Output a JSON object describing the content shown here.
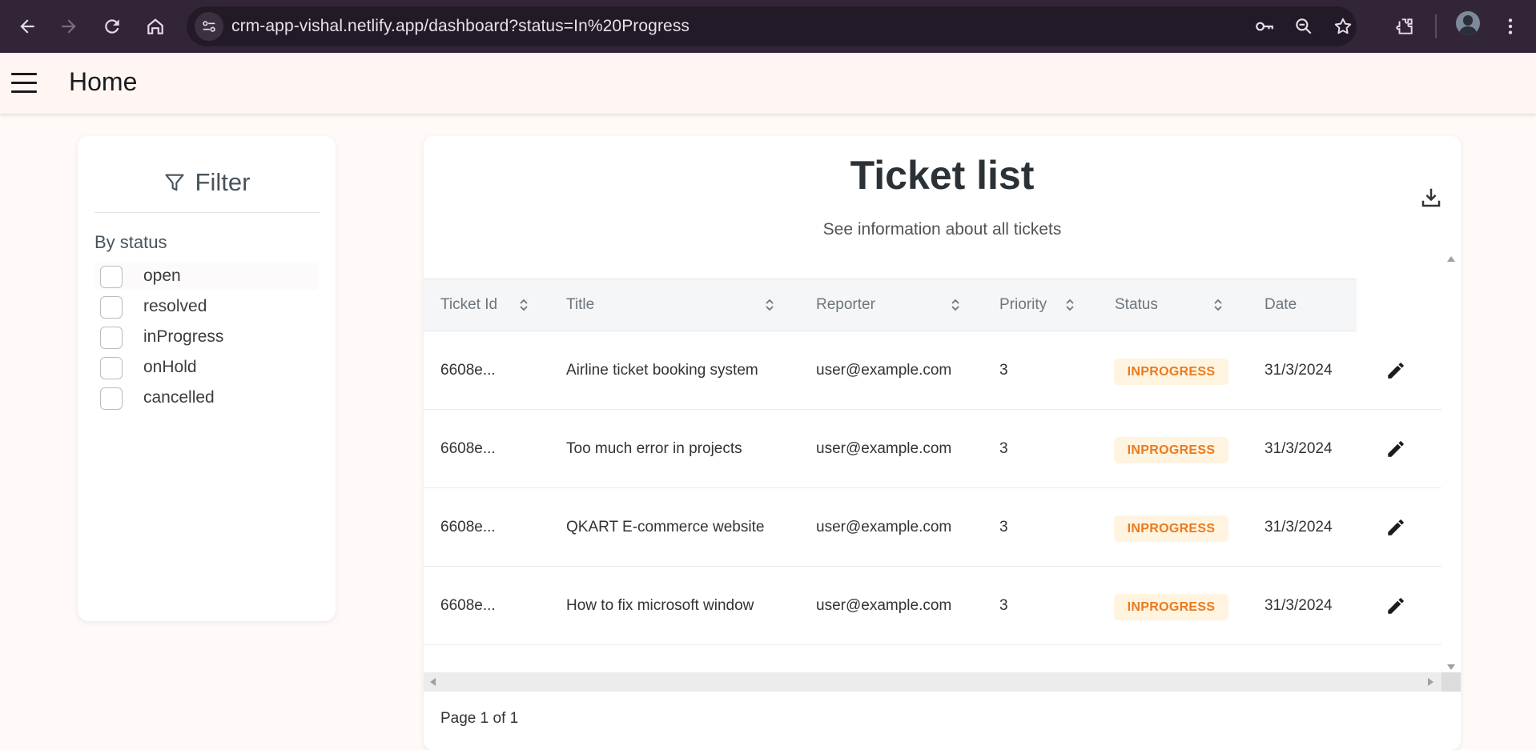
{
  "browser": {
    "url": "crm-app-vishal.netlify.app/dashboard?status=In%20Progress"
  },
  "app_bar": {
    "title": "Home"
  },
  "filter": {
    "title": "Filter",
    "section_label": "By status",
    "options": [
      {
        "label": "open",
        "checked": false
      },
      {
        "label": "resolved",
        "checked": false
      },
      {
        "label": "inProgress",
        "checked": false
      },
      {
        "label": "onHold",
        "checked": false
      },
      {
        "label": "cancelled",
        "checked": false
      }
    ]
  },
  "tickets": {
    "title": "Ticket list",
    "subtitle": "See information about all tickets",
    "columns": [
      "Ticket Id",
      "Title",
      "Reporter",
      "Priority",
      "Status",
      "Date"
    ],
    "rows": [
      {
        "id": "6608e...",
        "title": "Airline ticket booking system",
        "reporter": "user@example.com",
        "priority": "3",
        "status": "INPROGRESS",
        "date": "31/3/2024"
      },
      {
        "id": "6608e...",
        "title": "Too much error in projects",
        "reporter": "user@example.com",
        "priority": "3",
        "status": "INPROGRESS",
        "date": "31/3/2024"
      },
      {
        "id": "6608e...",
        "title": "QKART E-commerce website",
        "reporter": "user@example.com",
        "priority": "3",
        "status": "INPROGRESS",
        "date": "31/3/2024"
      },
      {
        "id": "6608e...",
        "title": "How to fix microsoft window",
        "reporter": "user@example.com",
        "priority": "3",
        "status": "INPROGRESS",
        "date": "31/3/2024"
      }
    ],
    "pagination": "Page 1 of 1"
  },
  "colors": {
    "browser_bar": "#332538",
    "status_badge_bg": "#fff4e0",
    "status_badge_text": "#ea7a1e",
    "app_background": "#fffaf8"
  },
  "icons": [
    "back-icon",
    "forward-icon",
    "reload-icon",
    "home-icon",
    "site-info-icon",
    "key-icon",
    "zoom-icon",
    "star-icon",
    "extensions-icon",
    "more-icon",
    "menu-icon",
    "filter-icon",
    "download-icon",
    "sort-icon",
    "edit-icon"
  ]
}
